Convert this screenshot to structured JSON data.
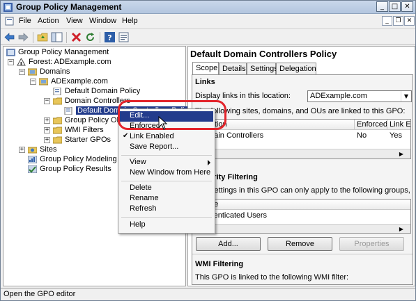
{
  "window": {
    "title": "Group Policy Management"
  },
  "menu": [
    "File",
    "Action",
    "View",
    "Window",
    "Help"
  ],
  "tree": {
    "root": "Group Policy Management",
    "forest": "Forest: ADExample.com",
    "domains": "Domains",
    "domain": "ADExample.com",
    "default_domain_policy": "Default Domain Policy",
    "domain_controllers": "Domain Controllers",
    "selected_node": "Default Domain Controllers Policy",
    "gpo_objects": "Group Policy Objects",
    "wmi_filters": "WMI Filters",
    "starter_gpos": "Starter GPOs",
    "sites": "Sites",
    "modeling": "Group Policy Modeling",
    "results": "Group Policy Results"
  },
  "right": {
    "title": "Default Domain Controllers Policy",
    "tabs": [
      "Scope",
      "Details",
      "Settings",
      "Delegation"
    ],
    "links": {
      "heading": "Links",
      "display_label": "Display links in this location:",
      "location_value": "ADExample.com",
      "linked_text": "The following sites, domains, and OUs are linked to this GPO:",
      "columns": [
        "Location",
        "Enforced",
        "Link Enabled"
      ],
      "rows": [
        {
          "location": "Domain Controllers",
          "enforced": "No",
          "link_enabled": "Yes"
        }
      ]
    },
    "security": {
      "heading": "Security Filtering",
      "text": "The settings in this GPO can only apply to the following groups, users, and computers:",
      "column": "Name",
      "rows": [
        "Authenticated Users"
      ],
      "buttons": {
        "add": "Add...",
        "remove": "Remove",
        "properties": "Properties"
      }
    },
    "wmi": {
      "heading": "WMI Filtering",
      "text": "This GPO is linked to the following WMI filter:"
    }
  },
  "context_menu": {
    "edit": "Edit...",
    "enforced": "Enforced",
    "link_enabled": "Link Enabled",
    "save_report": "Save Report...",
    "view": "View",
    "new_window": "New Window from Here",
    "delete": "Delete",
    "rename": "Rename",
    "refresh": "Refresh",
    "help": "Help"
  },
  "status": "Open the GPO editor",
  "colors": {
    "selection": "#233c8c",
    "callout": "#e3242b"
  }
}
